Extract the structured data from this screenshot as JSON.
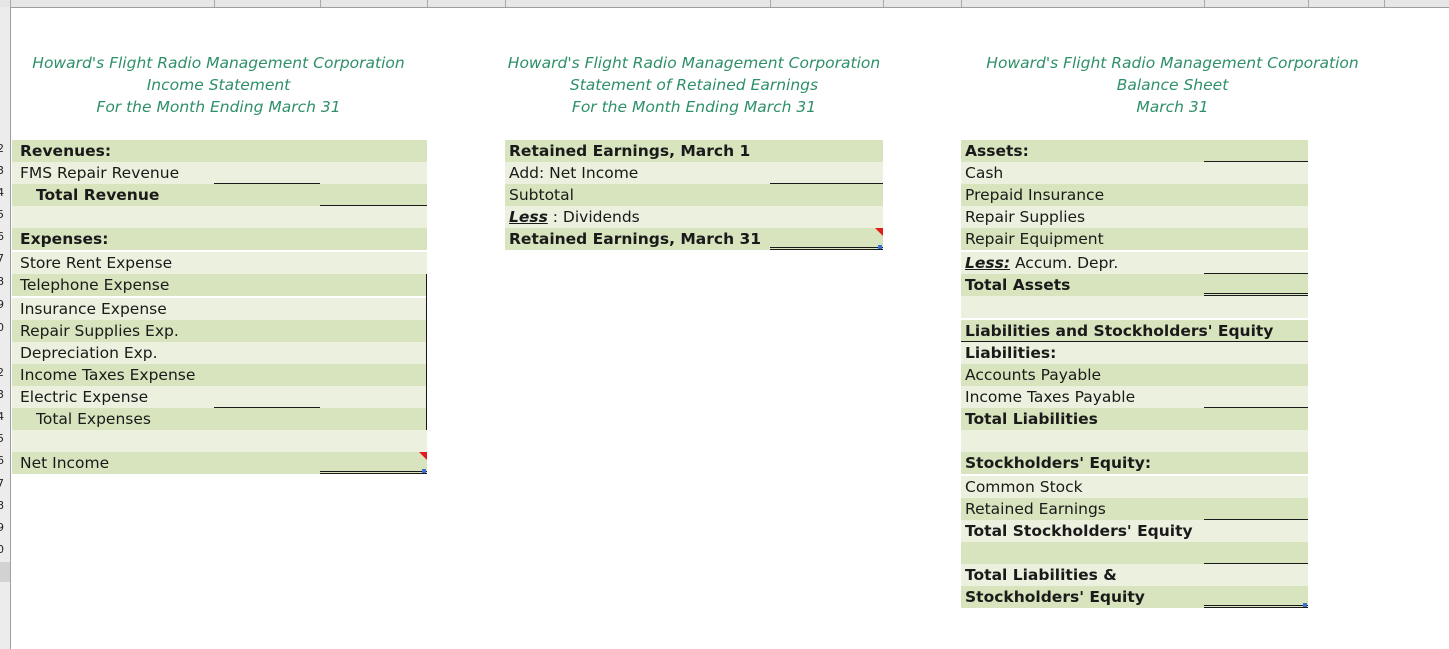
{
  "row_numbers": [
    "",
    "",
    "",
    "",
    "",
    "",
    "",
    "",
    "2",
    "3",
    "4",
    "5",
    "6",
    "7",
    "8",
    "9",
    "0",
    "",
    "2",
    "3",
    "4",
    "5",
    "6",
    "7",
    "8",
    "9",
    "0"
  ],
  "income_statement": {
    "title": [
      "Howard's Flight Radio Management Corporation",
      "Income Statement",
      "For the Month Ending March 31"
    ],
    "rows": [
      {
        "label": "Revenues:"
      },
      {
        "label": "FMS Repair Revenue"
      },
      {
        "label": "Total Revenue"
      },
      {
        "label": ""
      },
      {
        "label": "Expenses:"
      },
      {
        "label": "Store Rent Expense"
      },
      {
        "label": "Telephone Expense"
      },
      {
        "label": "Insurance Expense"
      },
      {
        "label": "Repair Supplies Exp."
      },
      {
        "label": "Depreciation Exp."
      },
      {
        "label": "Income Taxes Expense"
      },
      {
        "label": "Electric Expense"
      },
      {
        "label": "Total Expenses"
      },
      {
        "label": ""
      },
      {
        "label": "Net Income"
      }
    ]
  },
  "retained_earnings": {
    "title": [
      "Howard's Flight Radio Management Corporation",
      "Statement of Retained Earnings",
      "For the Month Ending March 31"
    ],
    "rows": [
      {
        "label": "Retained Earnings, March 1"
      },
      {
        "label": "Add: Net Income"
      },
      {
        "label": "Subtotal"
      },
      {
        "label_prefix": "Less",
        "label": " : Dividends"
      },
      {
        "label": "Retained Earnings, March 31"
      }
    ]
  },
  "balance_sheet": {
    "title": [
      "Howard's Flight Radio Management Corporation",
      "Balance Sheet",
      "March 31"
    ],
    "rows": [
      {
        "label": "Assets:"
      },
      {
        "label": "Cash"
      },
      {
        "label": "Prepaid Insurance"
      },
      {
        "label": "Repair Supplies"
      },
      {
        "label": "Repair Equipment"
      },
      {
        "label_prefix": "Less:",
        "label": "  Accum. Depr."
      },
      {
        "label": "Total Assets"
      },
      {
        "label": ""
      },
      {
        "label": "Liabilities and Stockholders' Equity"
      },
      {
        "label": "Liabilities:"
      },
      {
        "label": "Accounts Payable"
      },
      {
        "label": "Income Taxes Payable"
      },
      {
        "label": "Total Liabilities"
      },
      {
        "label": ""
      },
      {
        "label": "Stockholders' Equity:"
      },
      {
        "label": "Common Stock"
      },
      {
        "label": "Retained Earnings"
      },
      {
        "label": "Total Stockholders' Equity"
      },
      {
        "label": ""
      },
      {
        "label": "Total Liabilities &"
      },
      {
        "label": "Stockholders' Equity"
      }
    ]
  },
  "colors": {
    "title_green": "#2e9068",
    "band_dark": "#d7e4be",
    "band_light": "#ebf1de",
    "error_flag": "#e21a1a"
  }
}
